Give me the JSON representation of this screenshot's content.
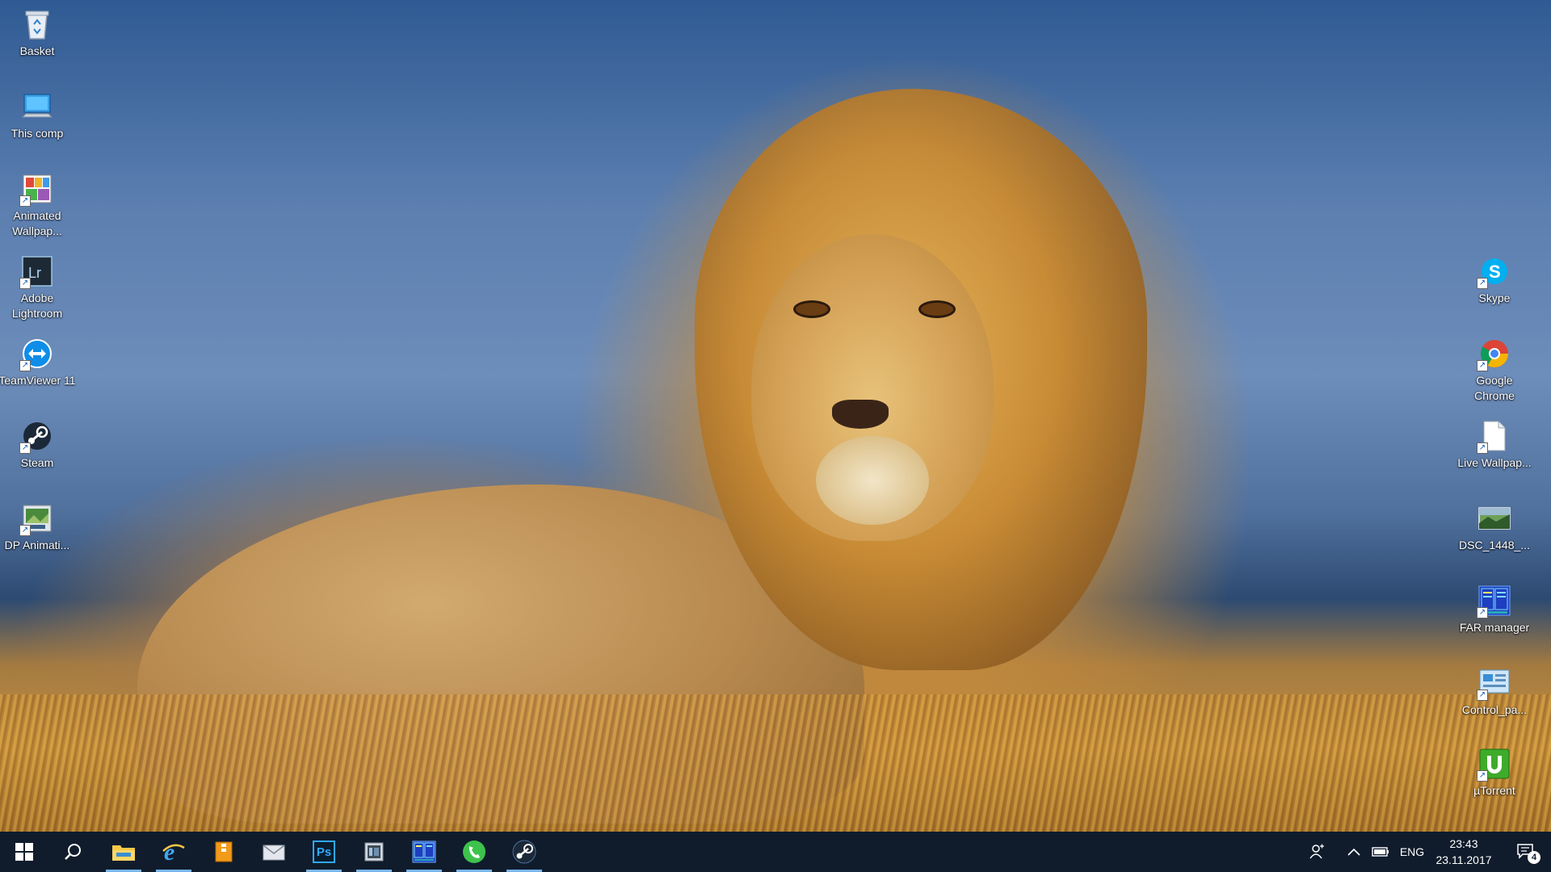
{
  "desktop": {
    "left_icons": [
      {
        "label": "Basket",
        "icon": "recycle-bin-icon"
      },
      {
        "label": "This comp",
        "icon": "computer-icon"
      },
      {
        "label": "Animated Wallpap...",
        "icon": "animated-wallpaper-icon"
      },
      {
        "label": "Adobe Lightroom",
        "icon": "lightroom-icon"
      },
      {
        "label": "TeamViewer 11",
        "icon": "teamviewer-icon"
      },
      {
        "label": "Steam",
        "icon": "steam-icon"
      },
      {
        "label": "DP Animati...",
        "icon": "dp-animation-icon"
      }
    ],
    "right_icons": [
      {
        "label": "Skype",
        "icon": "skype-icon"
      },
      {
        "label": "Google Chrome",
        "icon": "chrome-icon"
      },
      {
        "label": "Live Wallpap...",
        "icon": "document-icon"
      },
      {
        "label": "DSC_1448_...",
        "icon": "photo-thumbnail-icon"
      },
      {
        "label": "FAR manager",
        "icon": "far-manager-icon"
      },
      {
        "label": "Control_pa...",
        "icon": "control-panel-icon"
      },
      {
        "label": "µTorrent",
        "icon": "utorrent-icon"
      }
    ]
  },
  "taskbar": {
    "buttons": [
      {
        "name": "start-button",
        "icon": "windows-logo-icon"
      },
      {
        "name": "search-button",
        "icon": "search-icon"
      },
      {
        "name": "file-explorer-button",
        "icon": "folder-icon"
      },
      {
        "name": "internet-explorer-button",
        "icon": "ie-icon"
      },
      {
        "name": "archive-app-button",
        "icon": "archive-icon"
      },
      {
        "name": "mail-app-button",
        "icon": "mail-icon"
      },
      {
        "name": "photoshop-button",
        "icon": "photoshop-icon",
        "text": "Ps"
      },
      {
        "name": "media-app-button",
        "icon": "film-icon"
      },
      {
        "name": "far-manager-taskbar-button",
        "icon": "far-manager-icon"
      },
      {
        "name": "phone-app-button",
        "icon": "phone-icon"
      },
      {
        "name": "steam-taskbar-button",
        "icon": "steam-icon"
      }
    ],
    "tray": {
      "language": "ENG",
      "time": "23:43",
      "date": "23.11.2017",
      "notification_count": "4"
    }
  },
  "colors": {
    "taskbar_bg": "#101c2c",
    "active_indicator": "#79b6ea"
  }
}
